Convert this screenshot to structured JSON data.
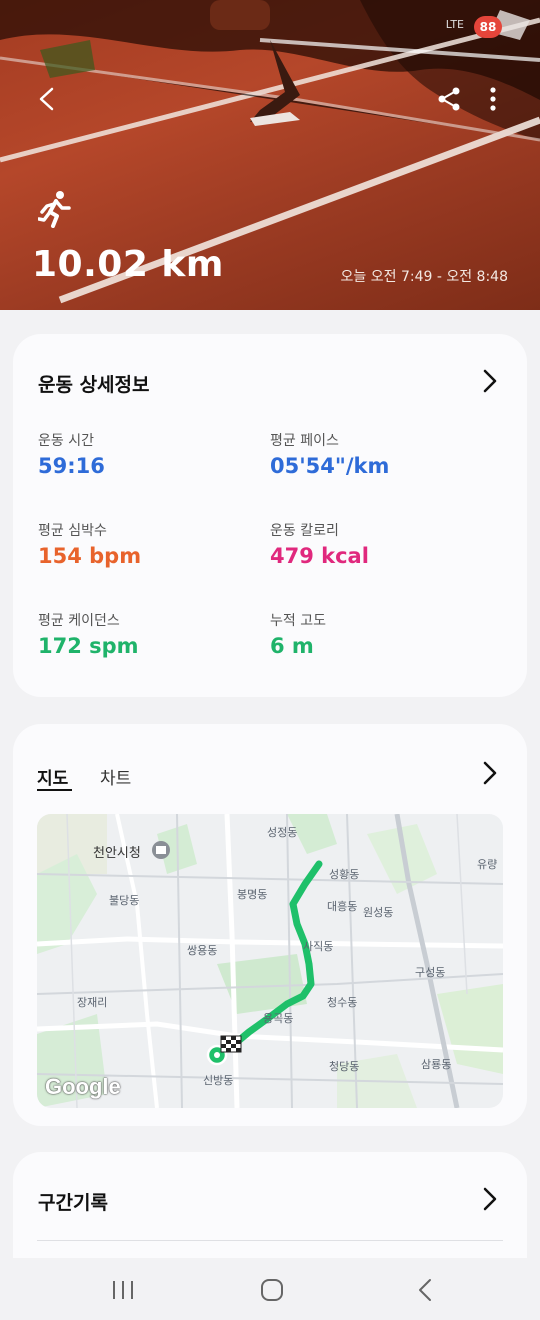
{
  "status_bar": {
    "network": "LTE",
    "battery": "88"
  },
  "header": {
    "distance": "10.02 km",
    "timeline": "오늘 오전 7:49 - 오전 8:48"
  },
  "workout_details": {
    "title": "운동 상세정보",
    "stats": [
      {
        "label": "운동 시간",
        "value": "59:16",
        "color": "#2e6bd8"
      },
      {
        "label": "평균 페이스",
        "value": "05'54\"/km",
        "color": "#2e6bd8"
      },
      {
        "label": "평균 심박수",
        "value": "154 bpm",
        "color": "#e8632c"
      },
      {
        "label": "운동 칼로리",
        "value": "479 kcal",
        "color": "#e0287d"
      },
      {
        "label": "평균 케이던스",
        "value": "172 spm",
        "color": "#1fb36a"
      },
      {
        "label": "누적 고도",
        "value": "6 m",
        "color": "#1fb36a"
      }
    ]
  },
  "map_card": {
    "tabs": [
      "지도",
      "차트"
    ],
    "labels": {
      "cheonan_city_hall": "천안시청",
      "seongjeong": "성정동",
      "seonghwang": "성황동",
      "yuryang": "유량",
      "bultang": "불당동",
      "bongmyeong": "봉명동",
      "daeheung": "대흥동",
      "wonseong": "원성동",
      "ssangyong": "쌍용동",
      "sajik": "사직동",
      "guseong": "구성동",
      "jangjae": "장재리",
      "cheongsu": "청수동",
      "yongam": "용곡동",
      "cheongdang": "청당동",
      "sambyong": "삼룡동",
      "sinbang": "신방동"
    },
    "attribution": "Google"
  },
  "splits": {
    "title": "구간기록"
  }
}
